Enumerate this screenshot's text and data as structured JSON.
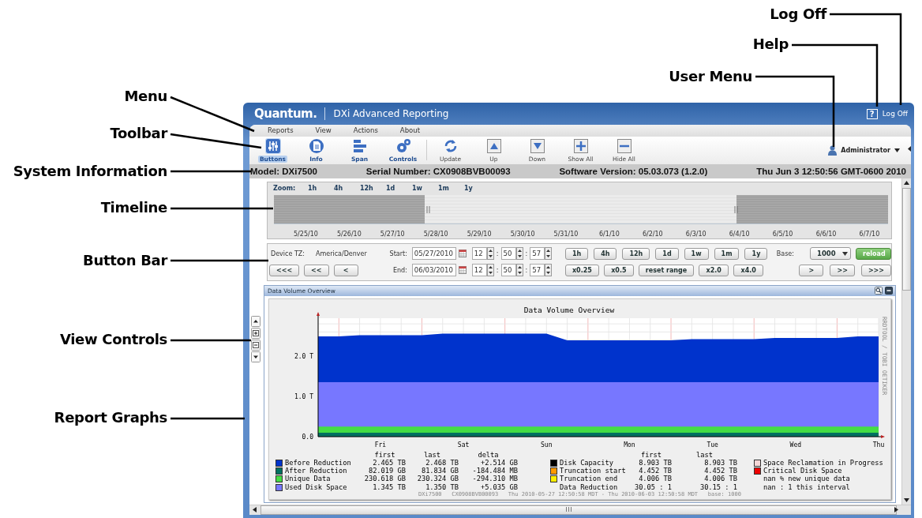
{
  "callouts": [
    {
      "label": "Log Off"
    },
    {
      "label": "Help"
    },
    {
      "label": "User Menu"
    },
    {
      "label": "Menu"
    },
    {
      "label": "Toolbar"
    },
    {
      "label": "System Information"
    },
    {
      "label": "Timeline"
    },
    {
      "label": "Button Bar"
    },
    {
      "label": "View Controls"
    },
    {
      "label": "Report Graphs"
    }
  ],
  "header": {
    "logo": "Quantum.",
    "title": "DXi Advanced Reporting",
    "help": "?",
    "log_off": "Log Off"
  },
  "menu": [
    "Reports",
    "View",
    "Actions",
    "About"
  ],
  "toolbar": [
    {
      "label": "Buttons",
      "kind": "sliders",
      "selected": true
    },
    {
      "label": "Info",
      "kind": "document",
      "selected": false
    },
    {
      "label": "Span",
      "kind": "bars",
      "selected": false
    },
    {
      "label": "Controls",
      "kind": "gears",
      "selected": false
    },
    {
      "label": "Update",
      "kind": "refresh",
      "selected": false
    },
    {
      "label": "Up",
      "kind": "up",
      "selected": false
    },
    {
      "label": "Down",
      "kind": "down",
      "selected": false
    },
    {
      "label": "Show All",
      "kind": "plus",
      "selected": false
    },
    {
      "label": "Hide All",
      "kind": "minus",
      "selected": false
    }
  ],
  "user_menu": "Administrator",
  "system_info": {
    "model": "Model: DXi7500",
    "serial": "Serial Number: CX0908BVB00093",
    "version": "Software Version: 05.03.073 (1.2.0)",
    "date": "Thu Jun 3 12:50:56 GMT-0600 2010"
  },
  "timeline": {
    "zoom_label": "Zoom:",
    "zoom": [
      "1h",
      "4h",
      "12h",
      "1d",
      "1w",
      "1m",
      "1y"
    ],
    "dates": [
      "5/25/10",
      "5/26/10",
      "5/27/10",
      "5/28/10",
      "5/29/10",
      "5/30/10",
      "5/31/10",
      "6/1/10",
      "6/2/10",
      "6/3/10",
      "6/4/10",
      "6/5/10",
      "6/6/10",
      "6/7/10"
    ]
  },
  "button_bar": {
    "tz_label": "Device TZ:",
    "tz": "America/Denver",
    "back": [
      "<<<",
      "<<",
      "<"
    ],
    "start": {
      "label": "Start:",
      "date": "05/27/2010",
      "hour": "12",
      "minute": "50",
      "second": "57"
    },
    "end": {
      "label": "End:",
      "date": "06/03/2010",
      "hour": "12",
      "minute": "50",
      "second": "57"
    },
    "separator": ":",
    "ranges": [
      "1h",
      "4h",
      "12h",
      "1d",
      "1w",
      "1m",
      "1y"
    ],
    "scales": [
      "x0.25",
      "x0.5",
      "reset range",
      "x2.0",
      "x4.0"
    ],
    "base_label": "Base:",
    "base": "1000",
    "reload": "reload",
    "forward": [
      ">",
      ">>",
      ">>>"
    ]
  },
  "report": {
    "title": "Data Volume Overview",
    "chart_data": {
      "type": "area",
      "title": "Data Volume Overview",
      "stacked": false,
      "categories": [
        null,
        null,
        null,
        "Fri",
        null,
        null,
        null,
        "Sat",
        null,
        null,
        null,
        "Sun",
        null,
        null,
        null,
        "Mon",
        null,
        null,
        null,
        "Tue",
        null,
        null,
        null,
        "Wed",
        null,
        null,
        null,
        "Thu"
      ],
      "ylim": [
        0,
        2.94
      ],
      "grid": true,
      "yticks": [
        {
          "value": 0,
          "label": "0.0"
        },
        {
          "value": 1,
          "label": "1.0 T"
        },
        {
          "value": 2,
          "label": "2.0 T"
        }
      ],
      "series": [
        {
          "name": "Before Reduction",
          "color": "#0033cc",
          "values": [
            2.49,
            2.49,
            2.52,
            2.52,
            2.52,
            2.52,
            2.56,
            2.56,
            2.56,
            2.56,
            2.56,
            2.56,
            2.39,
            2.39,
            2.39,
            2.39,
            2.39,
            2.39,
            2.42,
            2.42,
            2.42,
            2.42,
            2.45,
            2.45,
            2.45,
            2.45,
            2.49,
            2.49
          ]
        },
        {
          "name": "After Reduction",
          "color": "#007060",
          "values": [
            0.1,
            0.1,
            0.1,
            0.1,
            0.1,
            0.1,
            0.1,
            0.1,
            0.1,
            0.1,
            0.1,
            0.1,
            0.1,
            0.1,
            0.1,
            0.1,
            0.1,
            0.1,
            0.1,
            0.1,
            0.1,
            0.1,
            0.1,
            0.1,
            0.1,
            0.1,
            0.1,
            0.1
          ]
        },
        {
          "name": "Unique Data",
          "color": "#44dd44",
          "values": [
            0.25,
            0.25,
            0.25,
            0.25,
            0.25,
            0.25,
            0.25,
            0.25,
            0.25,
            0.25,
            0.25,
            0.25,
            0.25,
            0.25,
            0.25,
            0.25,
            0.25,
            0.25,
            0.25,
            0.25,
            0.25,
            0.25,
            0.25,
            0.25,
            0.25,
            0.25,
            0.25,
            0.25
          ]
        },
        {
          "name": "Used Disk Space",
          "color": "#7777ff",
          "values": [
            1.35,
            1.35,
            1.35,
            1.35,
            1.35,
            1.35,
            1.35,
            1.35,
            1.35,
            1.35,
            1.35,
            1.35,
            1.35,
            1.35,
            1.35,
            1.35,
            1.35,
            1.35,
            1.35,
            1.35,
            1.35,
            1.35,
            1.35,
            1.35,
            1.35,
            1.35,
            1.35,
            1.35
          ]
        }
      ]
    },
    "watermark": "RRDTOOL / TOBI OETIKER",
    "legend": {
      "headers": [
        "first",
        "last",
        "delta"
      ],
      "rows": [
        {
          "first": "2.465 TB",
          "last": "2.468 TB",
          "delta": "+2.514 GB"
        },
        {
          "first": "82.019 GB",
          "last": "81.834 GB",
          "delta": "-184.484 MB"
        },
        {
          "first": "230.618 GB",
          "last": "230.324 GB",
          "delta": "-294.310 MB"
        },
        {
          "first": "1.345 TB",
          "last": "1.350 TB",
          "delta": "+5.035 GB"
        }
      ],
      "capacity_headers": [
        "first",
        "last"
      ],
      "capacity_rows": [
        {
          "kind": "swatch",
          "name": "Disk Capacity",
          "color": "#000000",
          "first": "8.903 TB",
          "last": "8.903 TB"
        },
        {
          "kind": "swatch",
          "name": "Truncation start",
          "color": "#ff9900",
          "first": "4.452 TB",
          "last": "4.452 TB"
        },
        {
          "kind": "swatch",
          "name": "Truncation end",
          "color": "#ffee00",
          "first": "4.006 TB",
          "last": "4.006 TB"
        },
        {
          "kind": "plain",
          "name": "Data Reduction",
          "first": "30.05 : 1",
          "last": "30.15 : 1"
        }
      ],
      "status_rows": [
        {
          "kind": "swatch",
          "name": "Space Reclamation in Progress",
          "color": "#f4d6d6"
        },
        {
          "kind": "swatch",
          "name": "Critical Disk Space",
          "color": "#ee0000"
        },
        {
          "kind": "plain",
          "name": "nan % new unique data"
        },
        {
          "kind": "plain",
          "name": "nan : 1 this interval"
        }
      ]
    },
    "footer": "DXi7500   CX0908BVB00093   Thu 2010-05-27 12:50:58 MDT - Thu 2010-06-03 12:50:58 MDT   base: 1000"
  }
}
